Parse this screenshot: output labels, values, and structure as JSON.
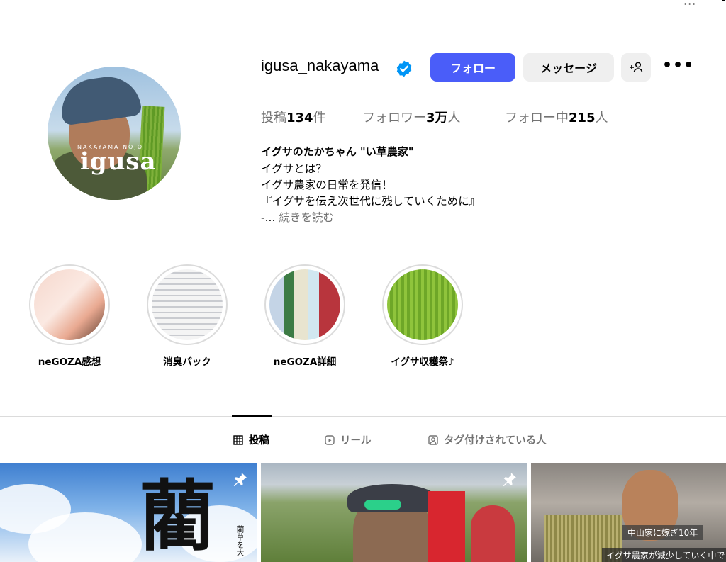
{
  "profile": {
    "username": "igusa_nakayama",
    "avatar_logo_small": "NAKAYAMA NOJO",
    "avatar_logo_big": "igusa",
    "buttons": {
      "follow": "フォロー",
      "message": "メッセージ",
      "add_user": "+8"
    },
    "stats": {
      "posts_label": "投稿",
      "posts_value": "134",
      "posts_suffix": "件",
      "followers_label": "フォロワー",
      "followers_value": "3万",
      "followers_suffix": "人",
      "following_label": "フォロー中",
      "following_value": "215",
      "following_suffix": "人"
    },
    "bio": {
      "name": "イグサのたかちゃん \"い草農家\"",
      "line1": "イグサとは？",
      "line2": "イグサ農家の日常を発信！",
      "line3": "『イグサを伝え次世代に残していくために』",
      "truncate_prefix": "-...",
      "more_link": "続きを読む"
    }
  },
  "highlights": [
    {
      "label": "neGOZA感想"
    },
    {
      "label": "消臭パック"
    },
    {
      "label": "neGOZA詳細"
    },
    {
      "label": "イグサ収穫祭♪"
    }
  ],
  "tabs": [
    {
      "label": "投稿",
      "icon": "grid-icon",
      "active": true
    },
    {
      "label": "リール",
      "icon": "reels-icon",
      "active": false
    },
    {
      "label": "タグ付けされている人",
      "icon": "tagged-icon",
      "active": false
    }
  ],
  "posts": [
    {
      "kanji": "藺",
      "vertical_text": "藺草を大"
    },
    {},
    {
      "caption1": "中山家に嫁ぎ10年",
      "caption2": "イグサ農家が減少していく中で"
    }
  ],
  "colors": {
    "follow_button": "#4a5df9",
    "secondary_button": "#efefef",
    "verified_badge": "#0095f6",
    "muted_text": "#737373",
    "divider": "#dbdbdb"
  }
}
